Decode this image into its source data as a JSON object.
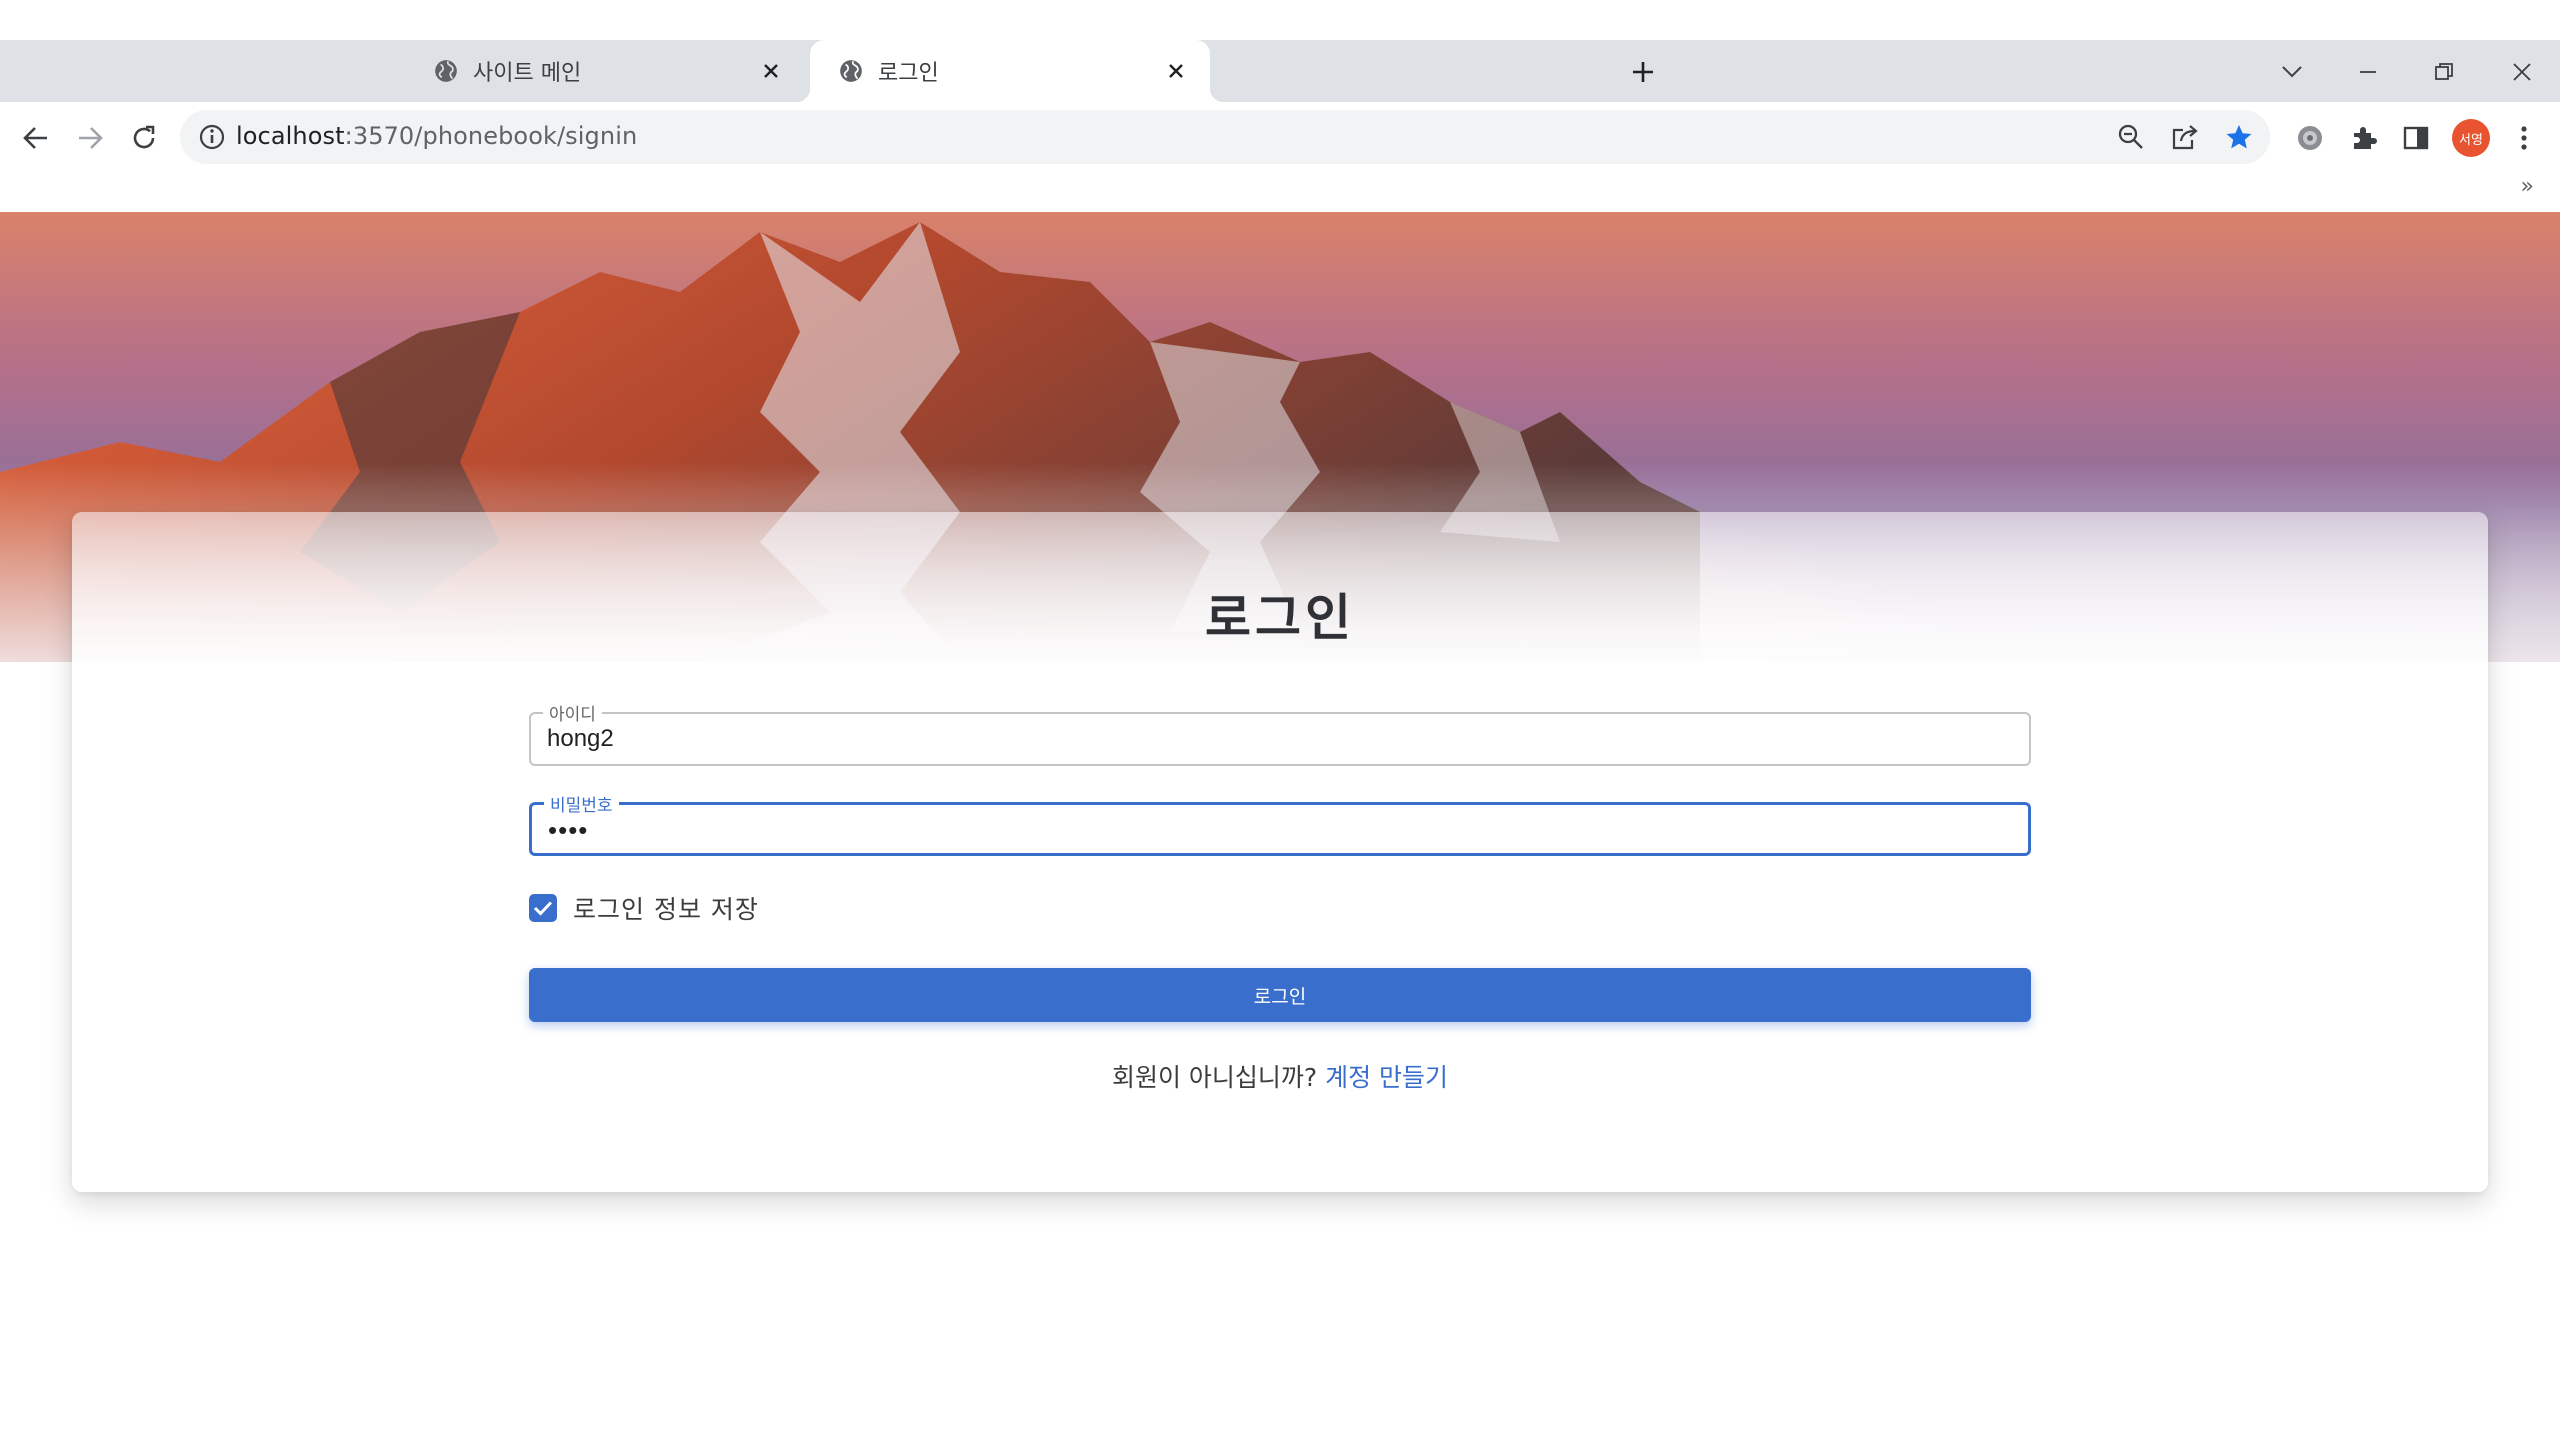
{
  "browser": {
    "tabs": [
      {
        "title": "사이트 메인",
        "active": false
      },
      {
        "title": "로그인",
        "active": true
      }
    ],
    "url_host": "localhost",
    "url_rest": ":3570/phonebook/signin",
    "profile_initials": "서영",
    "bookmarks_overflow": "»"
  },
  "page": {
    "title": "로그인",
    "id_label": "아이디",
    "id_value": "hong2",
    "password_label": "비밀번호",
    "password_value": "••••",
    "remember_label": "로그인 정보 저장",
    "remember_checked": true,
    "login_button": "로그인",
    "signup_prompt": "회원이 아니십니까?",
    "signup_link": "계정 만들기"
  },
  "colors": {
    "primary": "#3a6ecd",
    "tabstrip": "#dee1e6",
    "omnibox": "#f1f3f4",
    "avatar": "#e8542f"
  }
}
